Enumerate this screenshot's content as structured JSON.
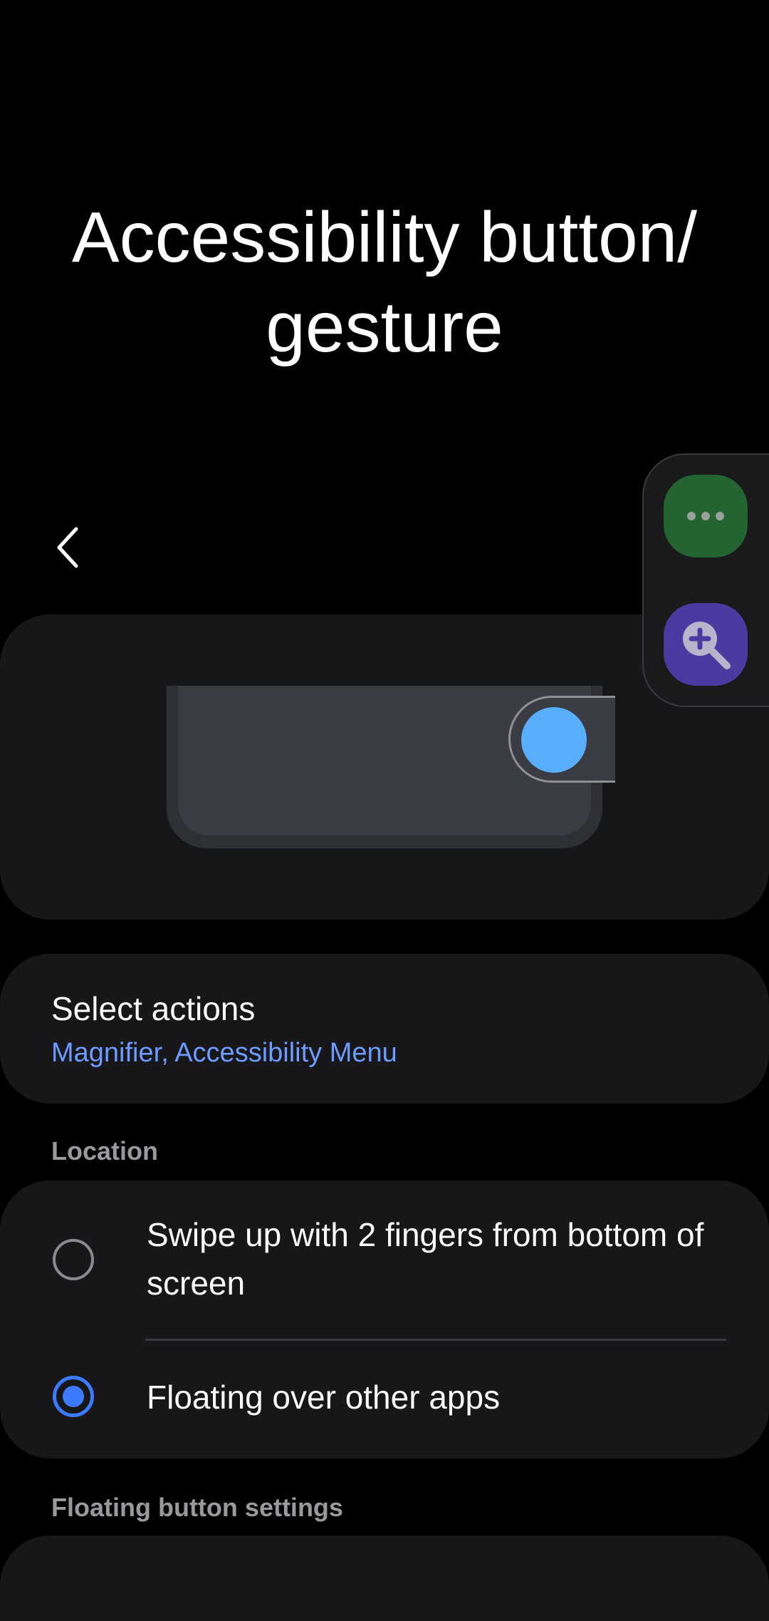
{
  "page": {
    "title": "Accessibility button/ gesture"
  },
  "icons": {
    "back": "chevron-left-icon",
    "menu": "more-horizontal-icon",
    "magnifier": "zoom-in-icon"
  },
  "colors": {
    "background": "#000000",
    "card": "#17171a",
    "accent": "#3c7bff",
    "link": "#6e9bff",
    "floating_dot": "#5aaefe",
    "menu_button": "#236432",
    "magnifier_button": "#4b3a9f"
  },
  "select_actions": {
    "title": "Select actions",
    "value": "Magnifier, Accessibility Menu"
  },
  "location": {
    "header": "Location",
    "options": [
      {
        "label": "Swipe up with 2 fingers from bottom of screen",
        "selected": false
      },
      {
        "label": "Floating over other apps",
        "selected": true
      }
    ]
  },
  "floating_settings": {
    "header": "Floating button settings"
  }
}
